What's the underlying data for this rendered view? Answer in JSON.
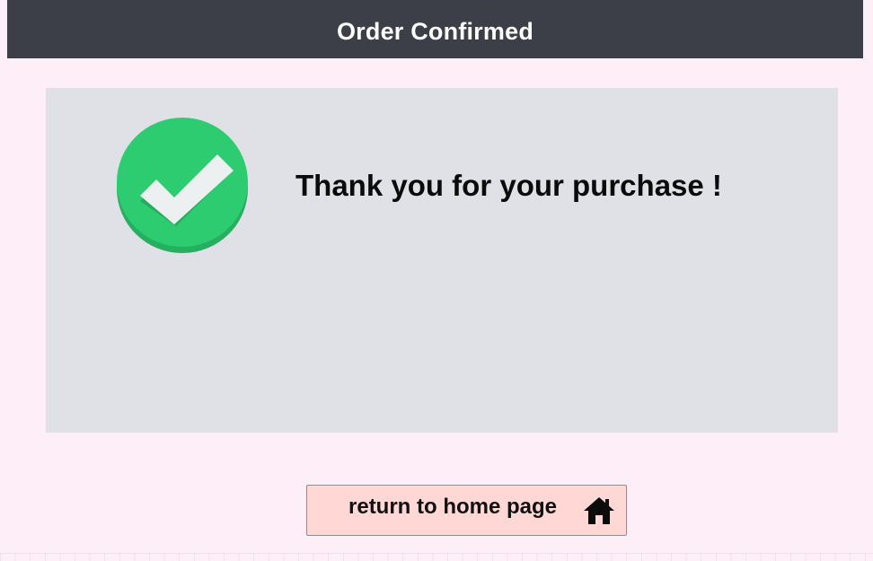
{
  "header": {
    "title": "Order Confirmed"
  },
  "confirmation": {
    "message": "Thank you for your purchase !",
    "icon": "check-circle-icon"
  },
  "home_button": {
    "label": "return to home page",
    "icon": "home-icon"
  },
  "colors": {
    "header_bg": "#3c3f48",
    "page_bg": "#fdeef8",
    "panel_bg": "#dfe1e6",
    "check_green": "#2ecc71",
    "button_bg": "#ffd8d6"
  }
}
